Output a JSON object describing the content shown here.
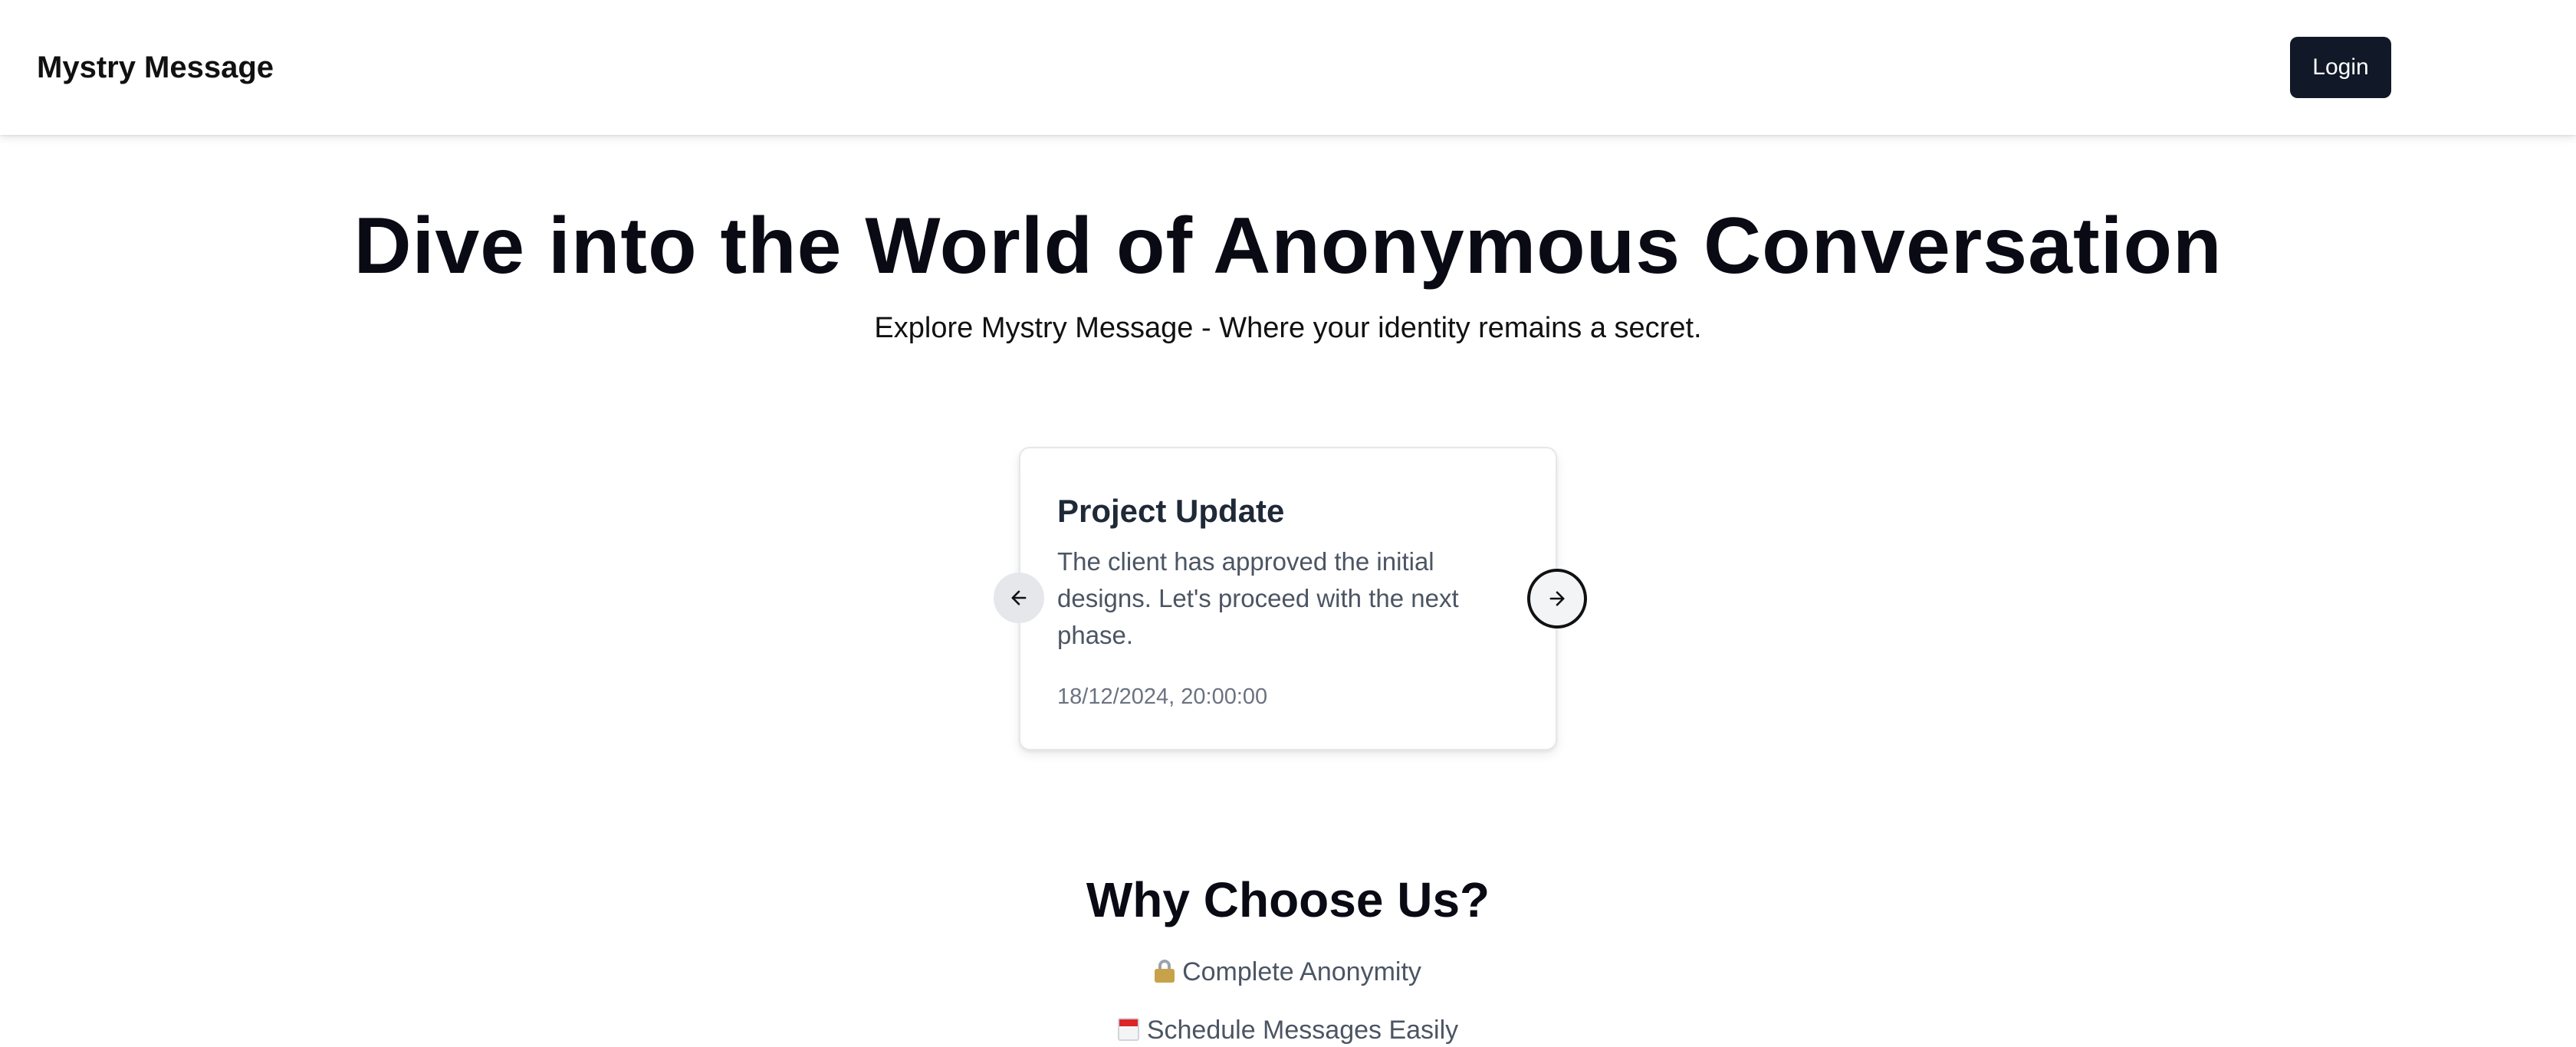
{
  "navbar": {
    "brand": "Mystry Message",
    "login_label": "Login"
  },
  "hero": {
    "title": "Dive into the World of Anonymous Conversation",
    "subtitle": "Explore Mystry Message - Where your identity remains a secret."
  },
  "carousel": {
    "prev_icon": "arrow-left-icon",
    "next_icon": "arrow-right-icon",
    "current": {
      "title": "Project Update",
      "content": "The client has approved the initial designs. Let's proceed with the next phase.",
      "date": "18/12/2024, 20:00:00"
    }
  },
  "why": {
    "title": "Why Choose Us?",
    "features": [
      {
        "icon": "lock-icon",
        "label": "Complete Anonymity"
      },
      {
        "icon": "calendar-icon",
        "label": "Schedule Messages Easily"
      }
    ]
  },
  "colors": {
    "primary_button": "#111827",
    "heading": "#0a0a14",
    "muted_text": "#4b5563",
    "card_border": "#e5e7eb"
  }
}
